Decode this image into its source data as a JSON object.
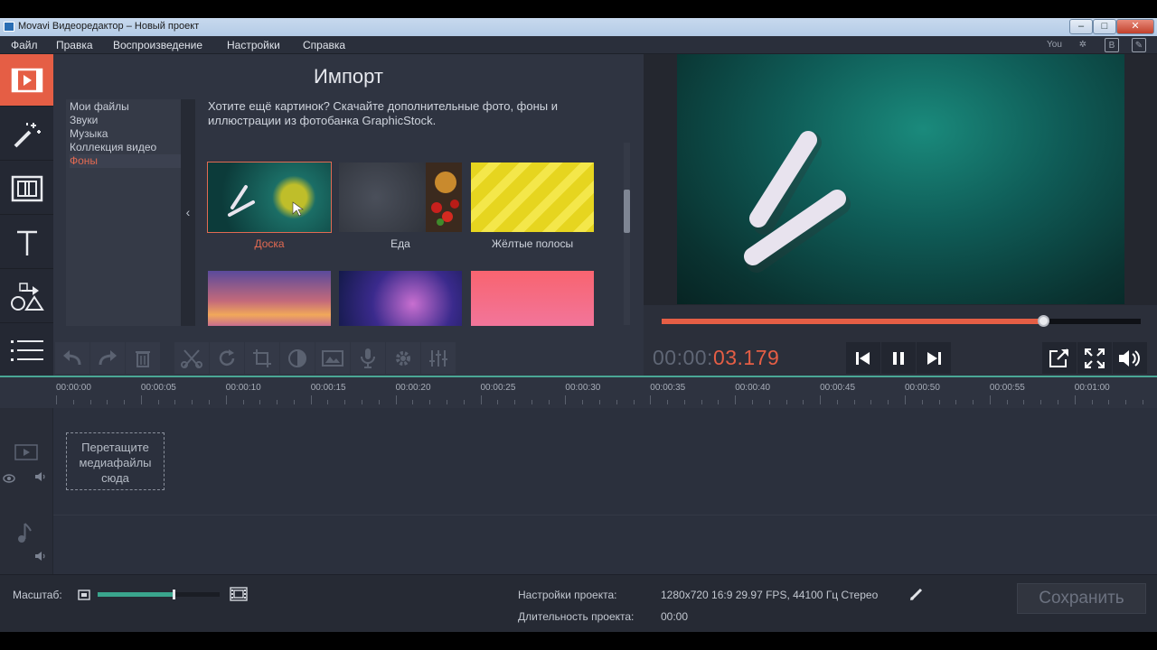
{
  "window": {
    "title": "Movavi Видеоредактор – Новый проект",
    "minimize": "‒",
    "maximize": "□",
    "close": "✕"
  },
  "menu": [
    "Файл",
    "Правка",
    "Воспроизведение",
    "Настройки",
    "Справка"
  ],
  "social_icons": [
    "youtube-icon",
    "odnoklassniki-icon",
    "vk-icon",
    "website-icon"
  ],
  "social_glyphs": [
    "You",
    "✲",
    "B",
    "✎"
  ],
  "left_tools": [
    "import-media-icon",
    "magic-wand-filters-icon",
    "transitions-icon",
    "titles-icon",
    "stickers-shapes-icon",
    "more-tools-icon"
  ],
  "import": {
    "title": "Импорт",
    "categories": [
      "Мои файлы",
      "Звуки",
      "Музыка",
      "Коллекция видео",
      "Фоны"
    ],
    "selected_category": "Фоны",
    "collapse_glyph": "‹",
    "promo": "Хотите ещё картинок? Скачайте дополнительные фото, фоны и иллюстрации из фотобанка GraphicStock.",
    "thumbnails": [
      {
        "label": "Доска",
        "selected": true
      },
      {
        "label": "Еда",
        "selected": false
      },
      {
        "label": "Жёлтые полосы",
        "selected": false
      },
      {
        "label": "",
        "selected": false
      },
      {
        "label": "",
        "selected": false
      },
      {
        "label": "",
        "selected": false
      }
    ]
  },
  "preview": {
    "seek_progress": 0.797
  },
  "edit_tools": [
    "undo-icon",
    "redo-icon",
    "delete-icon",
    "cut-icon",
    "rotate-icon",
    "crop-icon",
    "color-adjust-icon",
    "image-icon",
    "record-voice-icon",
    "settings-icon",
    "equalizer-icon"
  ],
  "playback": {
    "timecode_dim": "00:00:",
    "timecode_active": "03.179",
    "buttons": [
      "previous-icon",
      "pause-icon",
      "next-icon"
    ],
    "right_buttons": [
      "export-frame-icon",
      "fullscreen-icon",
      "volume-icon"
    ]
  },
  "timeline": {
    "ruler": [
      "00:00:00",
      "00:00:05",
      "00:00:10",
      "00:00:15",
      "00:00:20",
      "00:00:25",
      "00:00:30",
      "00:00:35",
      "00:00:40",
      "00:00:45",
      "00:00:50",
      "00:00:55",
      "00:01:00"
    ],
    "dropzone": "Перетащите медиафайлы сюда"
  },
  "bottom": {
    "zoom_label": "Масштаб:",
    "zoom_level": 0.62,
    "project_settings_label": "Настройки проекта:",
    "project_settings_value": "1280x720 16:9 29.97 FPS, 44100 Гц Стерео",
    "duration_label": "Длительность проекта:",
    "duration_value": "00:00",
    "save_button": "Сохранить"
  },
  "colors": {
    "accent": "#e55e45",
    "teal": "#3aa58d",
    "board": "#0f5c57"
  }
}
